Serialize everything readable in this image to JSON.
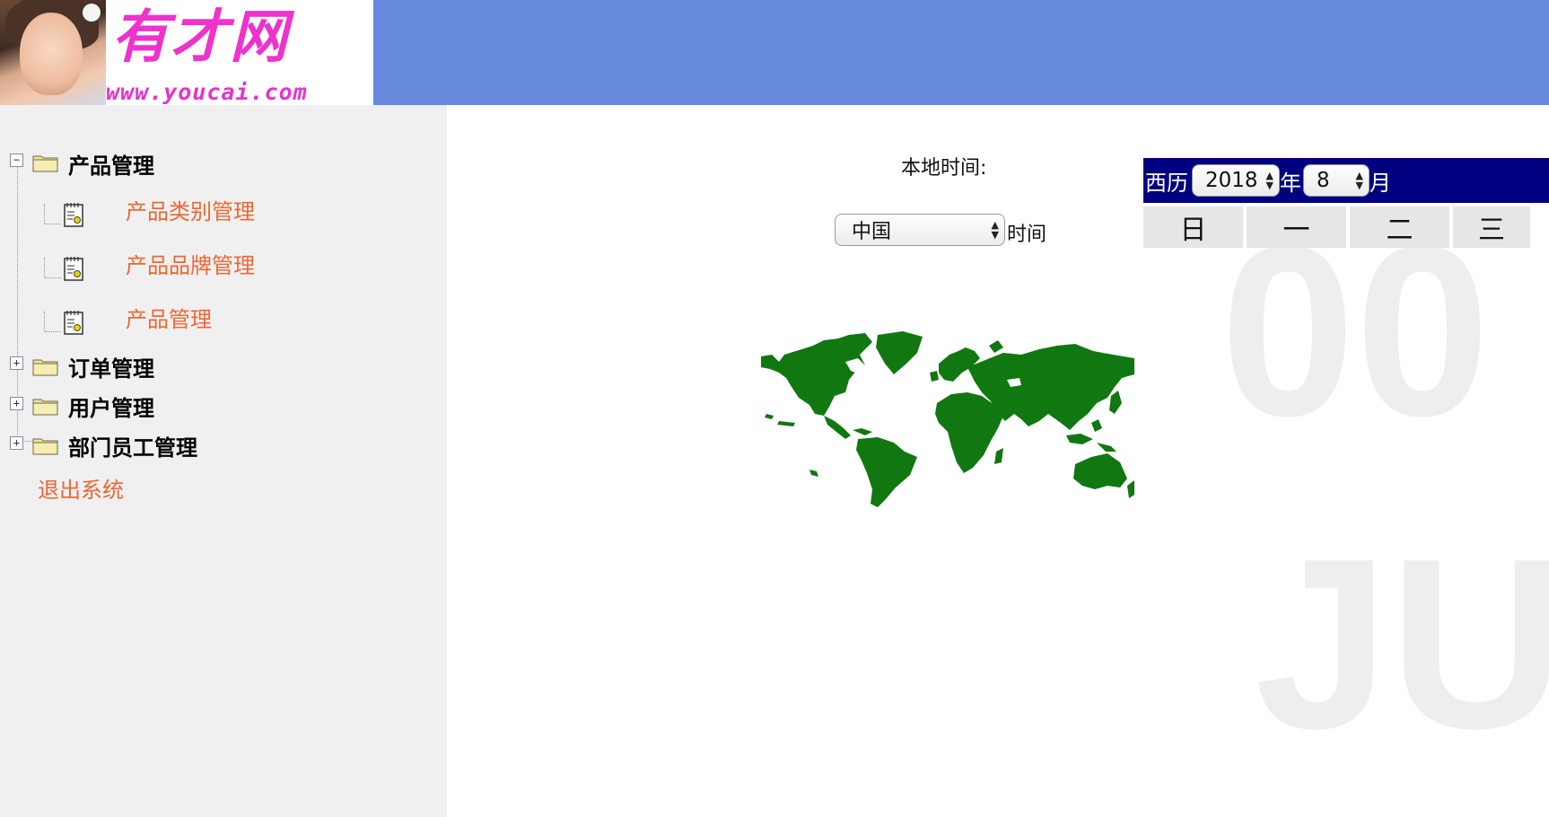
{
  "header": {
    "logo_title": "有才网",
    "logo_url": "www.youcai.com"
  },
  "sidebar": {
    "items": [
      {
        "label": "产品管理",
        "type": "folder",
        "expander": "−",
        "children": [
          {
            "label": "产品类别管理"
          },
          {
            "label": "产品品牌管理"
          },
          {
            "label": "产品管理"
          }
        ]
      },
      {
        "label": "订单管理",
        "type": "folder",
        "expander": "+"
      },
      {
        "label": "用户管理",
        "type": "folder",
        "expander": "+"
      },
      {
        "label": "部门员工管理",
        "type": "folder",
        "expander": "+"
      },
      {
        "label": "退出系统",
        "type": "link"
      }
    ]
  },
  "clock": {
    "local_time_label": "本地时间:",
    "country_selected": "中国",
    "time_suffix": "时间"
  },
  "calendar": {
    "era_label": "西历",
    "year": "2018",
    "year_suffix": "年",
    "month": "8",
    "month_suffix": "月",
    "weekdays": [
      "日",
      "一",
      "二",
      "三"
    ],
    "header_color": "#000080"
  },
  "background_text": {
    "number": "00",
    "month_abbr": "JU"
  },
  "colors": {
    "header_bar": "#6688dd",
    "sidebar_bg": "#f0f0f0",
    "link": "#ee6633",
    "map_land": "#117711"
  }
}
